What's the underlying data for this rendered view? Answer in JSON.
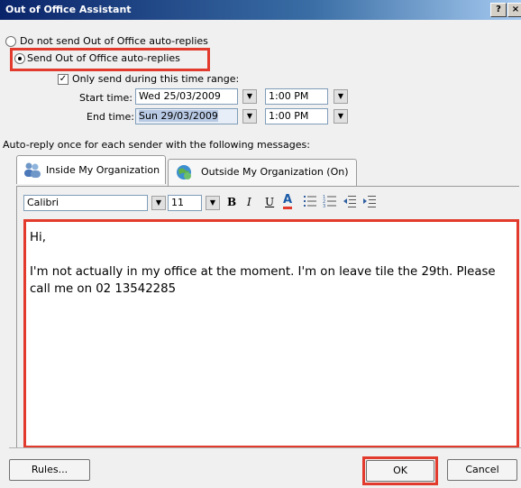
{
  "window": {
    "title": "Out of Office Assistant",
    "help_label": "?",
    "close_label": "×"
  },
  "options": {
    "do_not_send_label": "Do not send Out of Office auto-replies",
    "send_label": "Send Out of Office auto-replies",
    "selected": "send"
  },
  "time_range": {
    "only_send_label": "Only send during this time range:",
    "checked": true,
    "start_label": "Start time:",
    "start_date": "Wed 25/03/2009",
    "start_time": "1:00 PM",
    "end_label": "End time:",
    "end_date": "Sun 29/03/2009",
    "end_time": "1:00 PM"
  },
  "auto_reply_label": "Auto-reply once for each sender with the following messages:",
  "tabs": [
    {
      "label": "Inside My Organization",
      "icon": "people-icon",
      "active": true
    },
    {
      "label": "Outside My Organization (On)",
      "icon": "globe-icon",
      "active": false
    }
  ],
  "format_toolbar": {
    "font": "Calibri",
    "size": "11",
    "bold": "B",
    "italic": "I",
    "underline": "U",
    "font_color": "A",
    "accent_color": "#e23a2c"
  },
  "message": {
    "line1": "Hi,",
    "line2": "I'm not actually in my office at the moment. I'm on leave tile the 29th. Please call me on 02 13542285"
  },
  "footer": {
    "rules_label": "Rules...",
    "ok_label": "OK",
    "cancel_label": "Cancel"
  },
  "colors": {
    "highlight_box": "#e23a2c",
    "title_bar": "#0a246a"
  }
}
